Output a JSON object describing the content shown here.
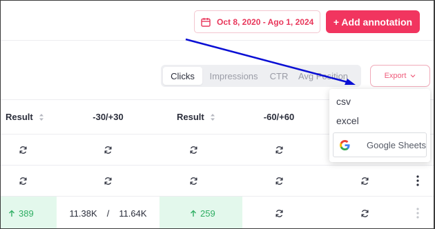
{
  "header": {
    "date_range": "Oct 8, 2020 - Ago 1, 2024",
    "add_annotation": "+ Add annotation"
  },
  "metric_tabs": [
    "Clicks",
    "Impressions",
    "CTR",
    "Avg Position"
  ],
  "active_tab": "Clicks",
  "export": {
    "label": "Export",
    "menu": {
      "csv": "csv",
      "excel": "excel",
      "google_sheets": "Google Sheets"
    }
  },
  "table": {
    "headers": [
      "Result",
      "-30/+30",
      "Result",
      "-60/+60"
    ],
    "row3": {
      "result1": "389",
      "range_a": "11.38K",
      "sep": "/",
      "range_b": "11.64K",
      "result2": "259"
    }
  },
  "colors": {
    "accent": "#f1355f",
    "positive": "#2fae63",
    "positive_bg": "#e3f8ec",
    "annotation_arrow": "#0a0fd4"
  },
  "icons": [
    "calendar-icon",
    "chevron-down-icon",
    "sort-icon",
    "refresh-icon",
    "more-vertical-icon",
    "google-icon",
    "arrow-up-icon"
  ]
}
